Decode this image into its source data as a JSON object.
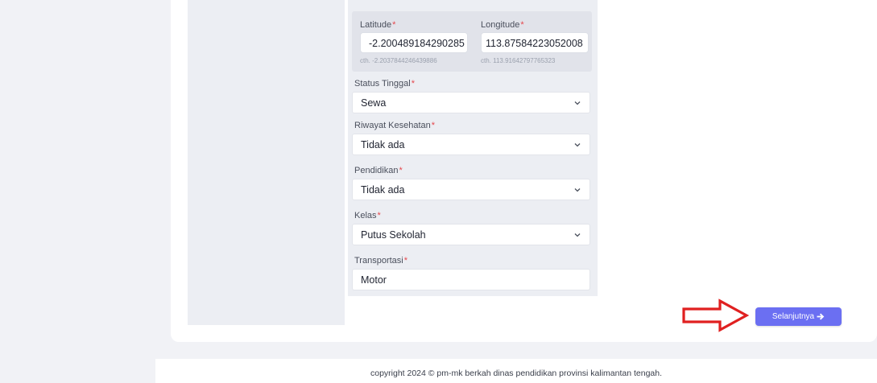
{
  "form": {
    "latitude": {
      "label": "Latitude",
      "required_mark": "*",
      "value": "-2.200489184290285",
      "hint": "cth. -2.2037844246439886"
    },
    "longitude": {
      "label": "Longitude",
      "required_mark": "*",
      "value": "113.87584223052008",
      "hint": "cth. 113.91642797765323"
    },
    "status_tinggal": {
      "label": "Status Tinggal",
      "required_mark": "*",
      "value": "Sewa"
    },
    "riwayat_kesehatan": {
      "label": "Riwayat Kesehatan",
      "required_mark": "*",
      "value": "Tidak ada"
    },
    "pendidikan": {
      "label": "Pendidikan",
      "required_mark": "*",
      "value": "Tidak ada"
    },
    "kelas": {
      "label": "Kelas",
      "required_mark": "*",
      "value": "Putus Sekolah"
    },
    "transportasi": {
      "label": "Transportasi",
      "required_mark": "*",
      "value": "Motor"
    }
  },
  "actions": {
    "next_label": "Selanjutnya",
    "next_icon": "arrow-right-icon"
  },
  "annotation": {
    "icon": "red-outline-arrow-icon",
    "color": "#e02020"
  },
  "footer": {
    "text": "copyright 2024 © pm-mk berkah dinas pendidikan provinsi kalimantan tengah."
  },
  "colors": {
    "accent": "#6b6ff2",
    "required": "#e5484d",
    "panel": "#eceef3"
  }
}
